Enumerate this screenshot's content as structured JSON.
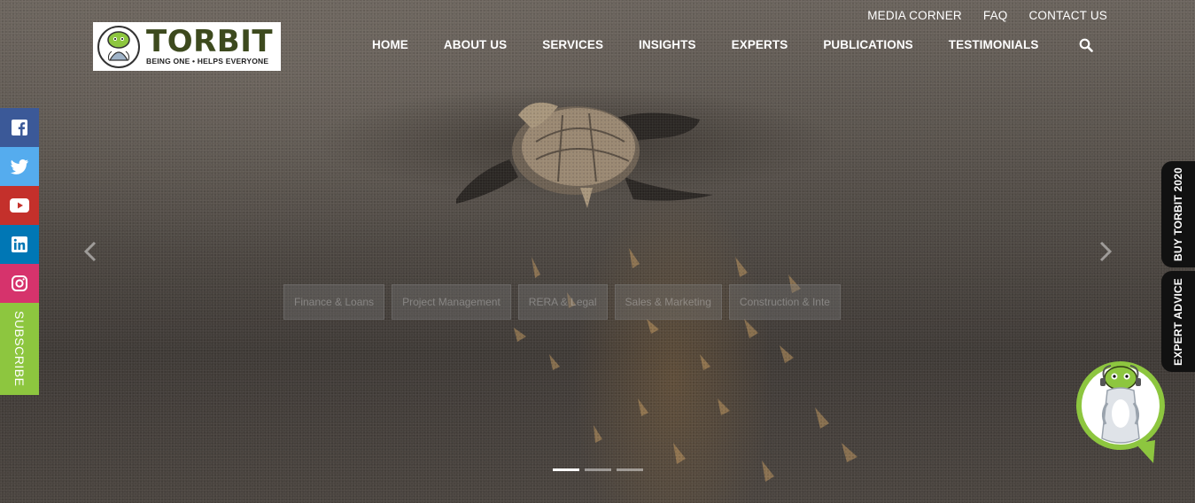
{
  "brand": {
    "name": "TORBIT",
    "tagline": "BEING ONE • HELPS EVERYONE"
  },
  "util_nav": [
    {
      "label": "MEDIA CORNER"
    },
    {
      "label": "FAQ"
    },
    {
      "label": "CONTACT US"
    }
  ],
  "main_nav": [
    {
      "label": "HOME"
    },
    {
      "label": "ABOUT US"
    },
    {
      "label": "SERVICES"
    },
    {
      "label": "INSIGHTS"
    },
    {
      "label": "EXPERTS"
    },
    {
      "label": "PUBLICATIONS"
    },
    {
      "label": "TESTIMONIALS"
    }
  ],
  "social": [
    "facebook-icon",
    "twitter-icon",
    "youtube-icon",
    "linkedin-icon",
    "instagram-icon"
  ],
  "subscribe_label": "SUBSCRIBE",
  "side_tabs": {
    "buy": "BUY TORBIT 2020",
    "expert": "EXPERT ADVICE"
  },
  "categories": [
    "Finance & Loans",
    "Project Management",
    "RERA & Legal",
    "Sales & Marketing",
    "Construction & Inte"
  ],
  "carousel": {
    "slide_count": 3,
    "active_index": 0
  },
  "colors": {
    "facebook": "#3b5998",
    "twitter": "#55acee",
    "youtube": "#c4302b",
    "linkedin": "#0077b5",
    "instagram": "#d6336c",
    "subscribe": "#8dc63f",
    "brand_green": "#3d4a1e"
  }
}
